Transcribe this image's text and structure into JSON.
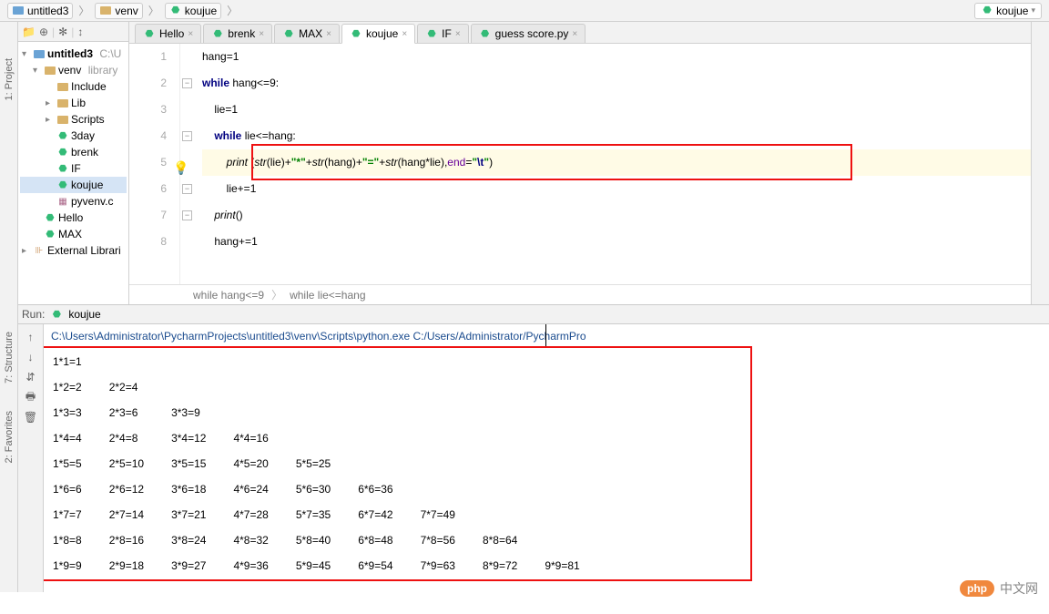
{
  "breadcrumb": {
    "items": [
      "untitled3",
      "venv",
      "koujue"
    ]
  },
  "file_selector": "koujue",
  "side_tabs": {
    "project": "1: Project"
  },
  "bottom_side_tabs": {
    "structure": "7: Structure",
    "favorites": "2: Favorites"
  },
  "project_tree": {
    "root": "untitled3",
    "root_suffix": "C:\\U",
    "venv": "venv",
    "venv_suffix": "library",
    "include": "Include",
    "lib": "Lib",
    "scripts": "Scripts",
    "day3": "3day",
    "brenk": "brenk",
    "if": "IF",
    "koujue": "koujue",
    "pyvenv": "pyvenv.c",
    "hello": "Hello",
    "max": "MAX",
    "ext": "External Librari"
  },
  "tabs": [
    {
      "label": "Hello",
      "active": false
    },
    {
      "label": "brenk",
      "active": false
    },
    {
      "label": "MAX",
      "active": false
    },
    {
      "label": "koujue",
      "active": true
    },
    {
      "label": "IF",
      "active": false
    },
    {
      "label": "guess score.py",
      "active": false
    }
  ],
  "code": {
    "l1": {
      "n": "1",
      "a": "hang",
      "b": "=",
      "c": "1"
    },
    "l2": {
      "n": "2",
      "a": "while",
      "b": " hang<=",
      "c": "9",
      "d": ":"
    },
    "l3": {
      "n": "3",
      "a": "lie=",
      "b": "1"
    },
    "l4": {
      "n": "4",
      "a": "while",
      "b": " lie<=hang:"
    },
    "l5": {
      "n": "5",
      "a": "print",
      "b": " (",
      "c": "str",
      "d": "(lie)+",
      "e": "\"*\"",
      "f": "+",
      "g": "str",
      "h": "(hang)+",
      "i": "\"=\"",
      "j": "+",
      "k": "str",
      "l": "(hang*lie),",
      "m": "end",
      "n2": "=",
      "o": "\"",
      "p": "\\t",
      "q": "\"",
      "r": ")"
    },
    "l6": {
      "n": "6",
      "a": "lie+=",
      "b": "1"
    },
    "l7": {
      "n": "7",
      "a": "print",
      "b": "()"
    },
    "l8": {
      "n": "8",
      "a": "hang+=",
      "b": "1"
    }
  },
  "context": {
    "a": "while hang<=9",
    "b": "while lie<=hang"
  },
  "run": {
    "label": "Run:",
    "name": "koujue",
    "path": "C:\\Users\\Administrator\\PycharmProjects\\untitled3\\venv\\Scripts\\python.exe C:/Users/Administrator/PycharmPro",
    "table": [
      [
        "1*1=1"
      ],
      [
        "1*2=2",
        "2*2=4"
      ],
      [
        "1*3=3",
        "2*3=6",
        "3*3=9"
      ],
      [
        "1*4=4",
        "2*4=8",
        "3*4=12",
        "4*4=16"
      ],
      [
        "1*5=5",
        "2*5=10",
        "3*5=15",
        "4*5=20",
        "5*5=25"
      ],
      [
        "1*6=6",
        "2*6=12",
        "3*6=18",
        "4*6=24",
        "5*6=30",
        "6*6=36"
      ],
      [
        "1*7=7",
        "2*7=14",
        "3*7=21",
        "4*7=28",
        "5*7=35",
        "6*7=42",
        "7*7=49"
      ],
      [
        "1*8=8",
        "2*8=16",
        "3*8=24",
        "4*8=32",
        "5*8=40",
        "6*8=48",
        "7*8=56",
        "8*8=64"
      ],
      [
        "1*9=9",
        "2*9=18",
        "3*9=27",
        "4*9=36",
        "5*9=45",
        "6*9=54",
        "7*9=63",
        "8*9=72",
        "9*9=81"
      ]
    ]
  },
  "watermark": {
    "logo": "php",
    "text": "中文网"
  }
}
